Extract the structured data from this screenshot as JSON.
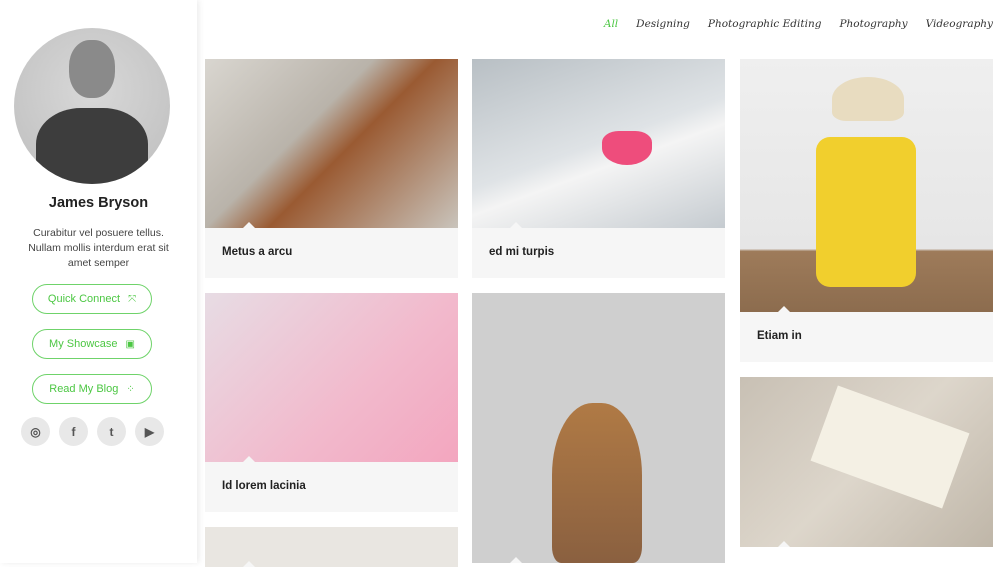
{
  "profile": {
    "name": "James Bryson",
    "bio": "Curabitur vel posuere tellus. Nullam mollis interdum erat sit amet semper",
    "buttons": [
      {
        "label": "Quick Connect",
        "icon": "expand-icon"
      },
      {
        "label": "My Showcase",
        "icon": "image-icon"
      },
      {
        "label": "Read My Blog",
        "icon": "spinner-icon"
      }
    ],
    "social": [
      "instagram-icon",
      "facebook-icon",
      "twitter-icon",
      "youtube-icon"
    ]
  },
  "nav": {
    "items": [
      "All",
      "Designing",
      "Photographic Editing",
      "Photography",
      "Videography"
    ],
    "active": "All",
    "accent": "#4cc743"
  },
  "portfolio": [
    {
      "title": "Metus a arcu",
      "image": "leather-tools"
    },
    {
      "title": "ed mi turpis",
      "image": "heart-drawing"
    },
    {
      "title": "Etiam in",
      "image": "yellow-suitcase"
    },
    {
      "title": "Id lorem lacinia",
      "image": "stationery"
    },
    {
      "title": "",
      "image": "cat"
    },
    {
      "title": "",
      "image": "book-starfish"
    },
    {
      "title": "",
      "image": "scissors"
    }
  ]
}
